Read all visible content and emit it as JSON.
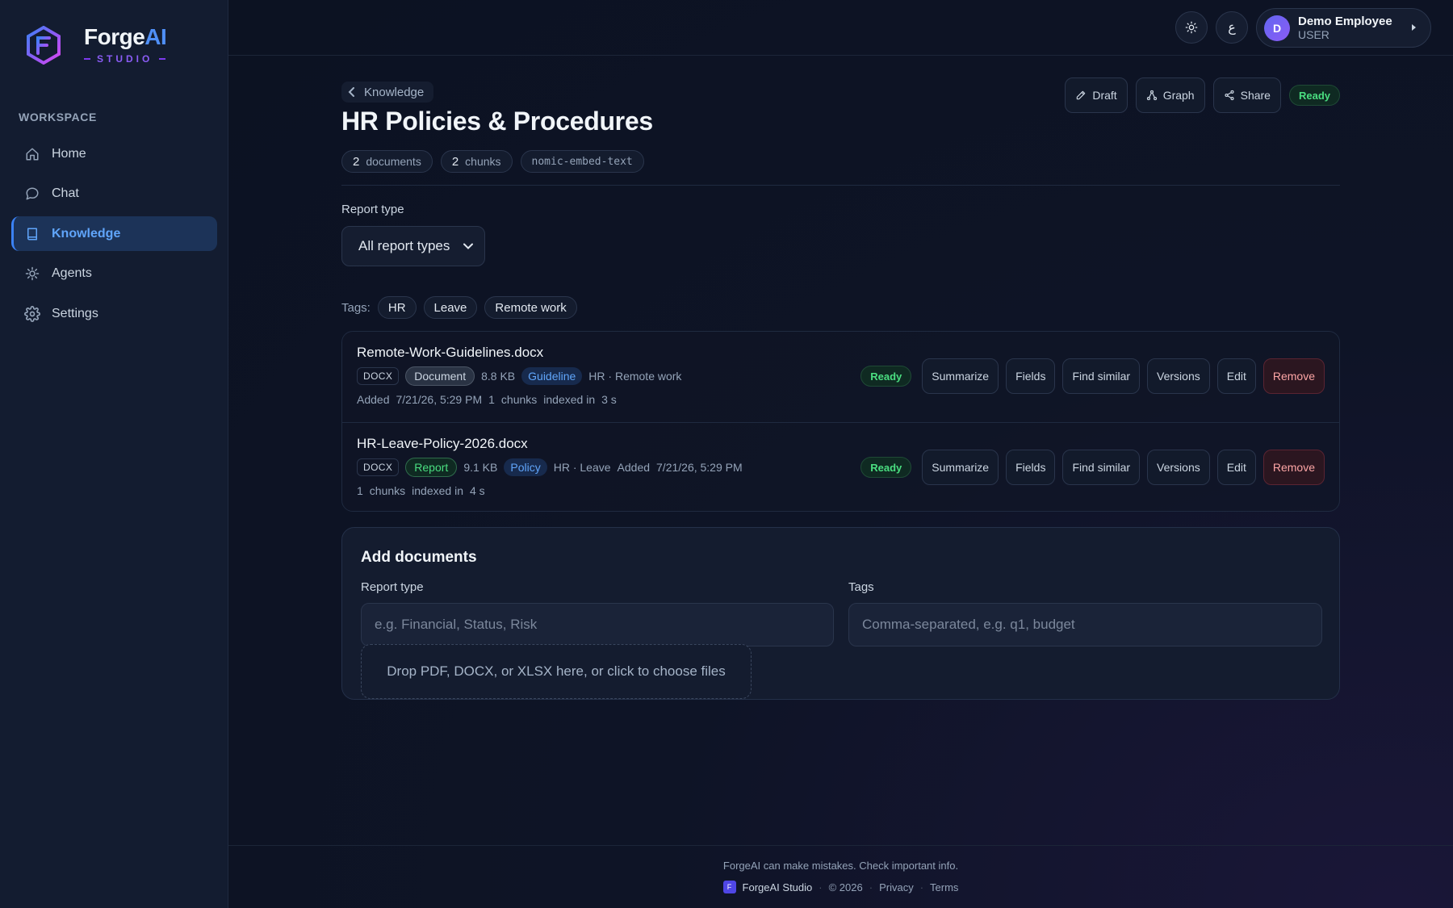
{
  "brand": {
    "name_main": "Forge",
    "name_accent": "AI",
    "subtitle": "STUDIO"
  },
  "sidebar": {
    "section_label": "WORKSPACE",
    "items": [
      {
        "label": "Home",
        "icon": "home-icon",
        "active": false
      },
      {
        "label": "Chat",
        "icon": "chat-icon",
        "active": false
      },
      {
        "label": "Knowledge",
        "icon": "book-icon",
        "active": true
      },
      {
        "label": "Agents",
        "icon": "agent-icon",
        "active": false
      },
      {
        "label": "Settings",
        "icon": "gear-icon",
        "active": false
      }
    ]
  },
  "topbar": {
    "theme_icon": "sun-icon",
    "language_glyph": "ع",
    "user": {
      "initial": "D",
      "name": "Demo Employee",
      "role": "USER"
    }
  },
  "page": {
    "breadcrumb": "Knowledge",
    "title": "HR Policies & Procedures",
    "meta": [
      {
        "value": "2",
        "label": "documents"
      },
      {
        "value": "2",
        "label": "chunks"
      }
    ],
    "embed_model": "nomic-embed-text",
    "actions": {
      "draft": "Draft",
      "graph": "Graph",
      "share": "Share",
      "status": "Ready"
    }
  },
  "filters": {
    "report_type_label": "Report type",
    "report_type_selected": "All report types",
    "tags_label": "Tags:",
    "tags": [
      "HR",
      "Leave",
      "Remote work"
    ]
  },
  "documents": [
    {
      "name": "Remote-Work-Guidelines.docx",
      "format": "DOCX",
      "type": "Document",
      "size": "8.8",
      "size_unit": "KB",
      "category": "Guideline",
      "tags": "HR · Remote work",
      "added_label": "Added",
      "added": "7/21/26, 5:29 PM",
      "chunks": "1",
      "chunks_label": "chunks",
      "indexed_label": "indexed in",
      "indexed_time": "3",
      "indexed_unit": "s",
      "status": "Ready"
    },
    {
      "name": "HR-Leave-Policy-2026.docx",
      "format": "DOCX",
      "type": "Report",
      "size": "9.1",
      "size_unit": "KB",
      "category": "Policy",
      "tags": "HR · Leave",
      "added_label": "Added",
      "added": "7/21/26, 5:29 PM",
      "chunks": "1",
      "chunks_label": "chunks",
      "indexed_label": "indexed in",
      "indexed_time": "4",
      "indexed_unit": "s",
      "status": "Ready"
    }
  ],
  "row_actions": {
    "summarize": "Summarize",
    "fields": "Fields",
    "find_similar": "Find similar",
    "versions": "Versions",
    "edit": "Edit",
    "remove": "Remove"
  },
  "add_documents": {
    "title": "Add documents",
    "report_type_label": "Report type",
    "report_type_placeholder": "e.g. Financial, Status, Risk",
    "tags_label": "Tags",
    "tags_placeholder": "Comma-separated, e.g. q1, budget",
    "drop_text": "Drop PDF, DOCX, or XLSX here, or click to choose files"
  },
  "footer": {
    "disclaimer": "ForgeAI can make mistakes. Check important info.",
    "logo_letter": "F",
    "app_name": "ForgeAI Studio",
    "copyright": "© 2026",
    "privacy": "Privacy",
    "terms": "Terms"
  },
  "colors": {
    "accent": "#3b82f6",
    "ready_green": "#4ade80",
    "danger": "#fca5a5",
    "background": "#0c1222"
  }
}
